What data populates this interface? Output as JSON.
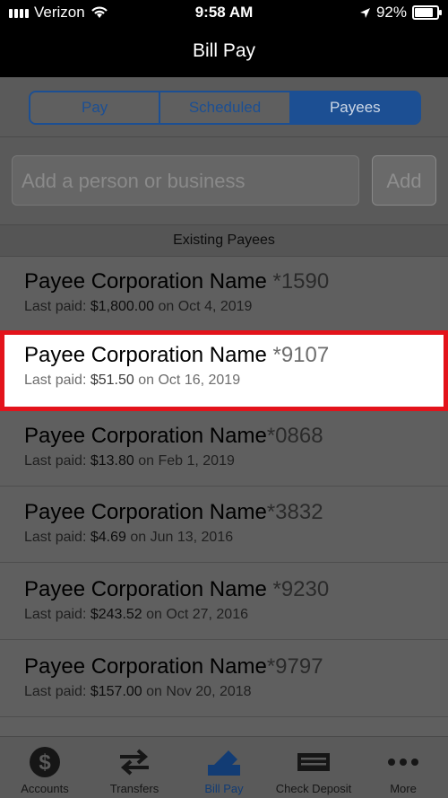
{
  "status_bar": {
    "carrier": "Verizon",
    "time": "9:58 AM",
    "battery": "92%",
    "battery_level": 0.92
  },
  "nav": {
    "title": "Bill Pay"
  },
  "segments": [
    {
      "label": "Pay"
    },
    {
      "label": "Scheduled"
    },
    {
      "label": "Payees",
      "selected": true
    }
  ],
  "search": {
    "placeholder": "Add a person or business",
    "add_label": "Add"
  },
  "section": {
    "title": "Existing Payees"
  },
  "payees": [
    {
      "name": "Payee Corporation Name",
      "account": "*1590",
      "last_paid_label": "Last paid:",
      "amount": "$1,800.00",
      "date": "on Oct 4, 2019"
    },
    {
      "name": "Payee Corporation Name",
      "account": "*9107",
      "last_paid_label": "Last paid:",
      "amount": "$51.50",
      "date": "on Oct 16, 2019"
    },
    {
      "name": "Payee Corporation Name",
      "account": "*0868",
      "last_paid_label": "Last paid:",
      "amount": "$13.80",
      "date": "on Feb 1, 2019"
    },
    {
      "name": "Payee Corporation Name",
      "account": "*3832",
      "last_paid_label": "Last paid:",
      "amount": "$4.69",
      "date": "on Jun 13, 2016"
    },
    {
      "name": "Payee Corporation Name",
      "account": "*9230",
      "last_paid_label": "Last paid:",
      "amount": "$243.52",
      "date": "on Oct 27, 2016"
    },
    {
      "name": "Payee Corporation Name",
      "account": "*9797",
      "last_paid_label": "Last paid:",
      "amount": "$157.00",
      "date": "on Nov 20, 2018"
    }
  ],
  "tabbar": [
    {
      "label": "Accounts",
      "icon": "dollar-icon"
    },
    {
      "label": "Transfers",
      "icon": "transfer-arrows-icon"
    },
    {
      "label": "Bill Pay",
      "icon": "bill-pay-icon",
      "active": true
    },
    {
      "label": "Check Deposit",
      "icon": "check-icon"
    },
    {
      "label": "More",
      "icon": "more-dots-icon"
    }
  ],
  "colors": {
    "accent": "#1c4f93",
    "highlight_border": "#e3131b"
  }
}
